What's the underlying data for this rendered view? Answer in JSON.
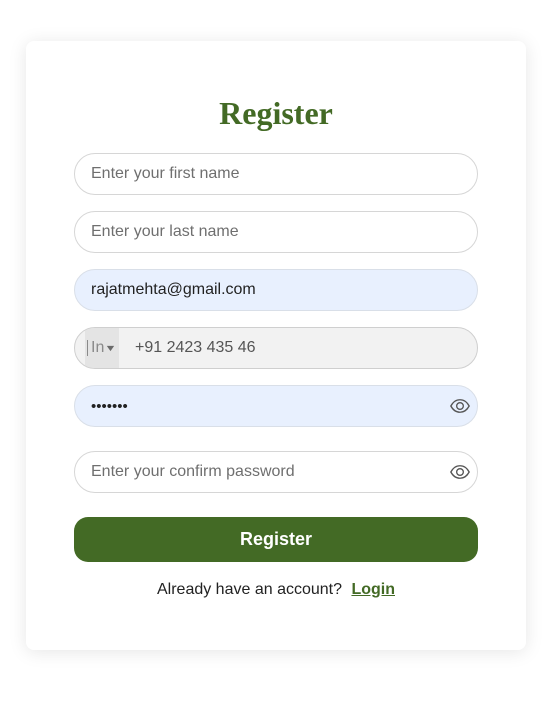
{
  "form": {
    "title": "Register",
    "first_name": {
      "value": "",
      "placeholder": "Enter your first name"
    },
    "last_name": {
      "value": "",
      "placeholder": "Enter your last name"
    },
    "email": {
      "value": "rajatmehta@gmail.com",
      "placeholder": ""
    },
    "phone": {
      "country_code": "In",
      "value": "+91 2423 435 46"
    },
    "password": {
      "value": "•••••••",
      "placeholder": ""
    },
    "confirm_password": {
      "value": "",
      "placeholder": "Enter your confirm password"
    },
    "submit_label": "Register",
    "footer_text": "Already have an account?",
    "login_label": "Login"
  },
  "colors": {
    "accent": "#436a25",
    "autofill_bg": "#e8f0fe"
  },
  "icons": {
    "password_toggle": "eye-icon",
    "confirm_toggle": "eye-icon",
    "country_dropdown": "chevron-down-icon"
  }
}
